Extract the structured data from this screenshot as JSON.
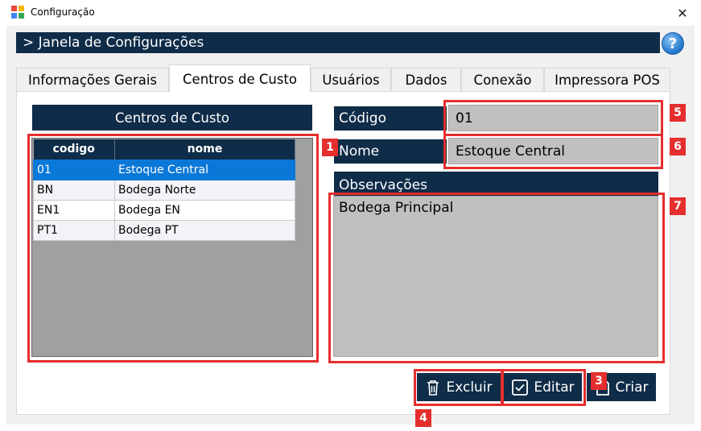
{
  "window": {
    "title": "Configuração",
    "close_glyph": "✕"
  },
  "header": {
    "title": "> Janela de Configurações",
    "help_glyph": "?"
  },
  "tabs": [
    {
      "label": "Informações Gerais",
      "active": false
    },
    {
      "label": "Centros de Custo",
      "active": true
    },
    {
      "label": "Usuários",
      "active": false
    },
    {
      "label": "Dados",
      "active": false
    },
    {
      "label": "Conexão",
      "active": false
    },
    {
      "label": "Impressora POS",
      "active": false
    }
  ],
  "list": {
    "title": "Centros de Custo",
    "columns": [
      "codigo",
      "nome"
    ],
    "rows": [
      {
        "codigo": "01",
        "nome": "Estoque Central",
        "selected": true
      },
      {
        "codigo": "BN",
        "nome": "Bodega Norte",
        "selected": false
      },
      {
        "codigo": "EN1",
        "nome": "Bodega EN",
        "selected": false
      },
      {
        "codigo": "PT1",
        "nome": "Bodega PT",
        "selected": false
      }
    ]
  },
  "form": {
    "codigo_label": "Código",
    "codigo_value": "01",
    "nome_label": "Nome",
    "nome_value": "Estoque Central",
    "obs_label": "Observações",
    "obs_value": "Bodega Principal"
  },
  "buttons": {
    "excluir": "Excluir",
    "editar": "Editar",
    "criar": "Criar"
  },
  "annotations": [
    "1",
    "3",
    "4",
    "5",
    "6",
    "7"
  ],
  "colors": {
    "navy": "#0f2c48",
    "selection": "#0a78d7",
    "annotation_red": "#e52e2e",
    "field_gray": "#c0c0c0"
  },
  "icons": {
    "app": "app-logo-icon",
    "help": "help-icon",
    "close": "close-icon",
    "trash": "trash-icon",
    "edit": "checkbox-icon",
    "create": "new-document-icon"
  }
}
